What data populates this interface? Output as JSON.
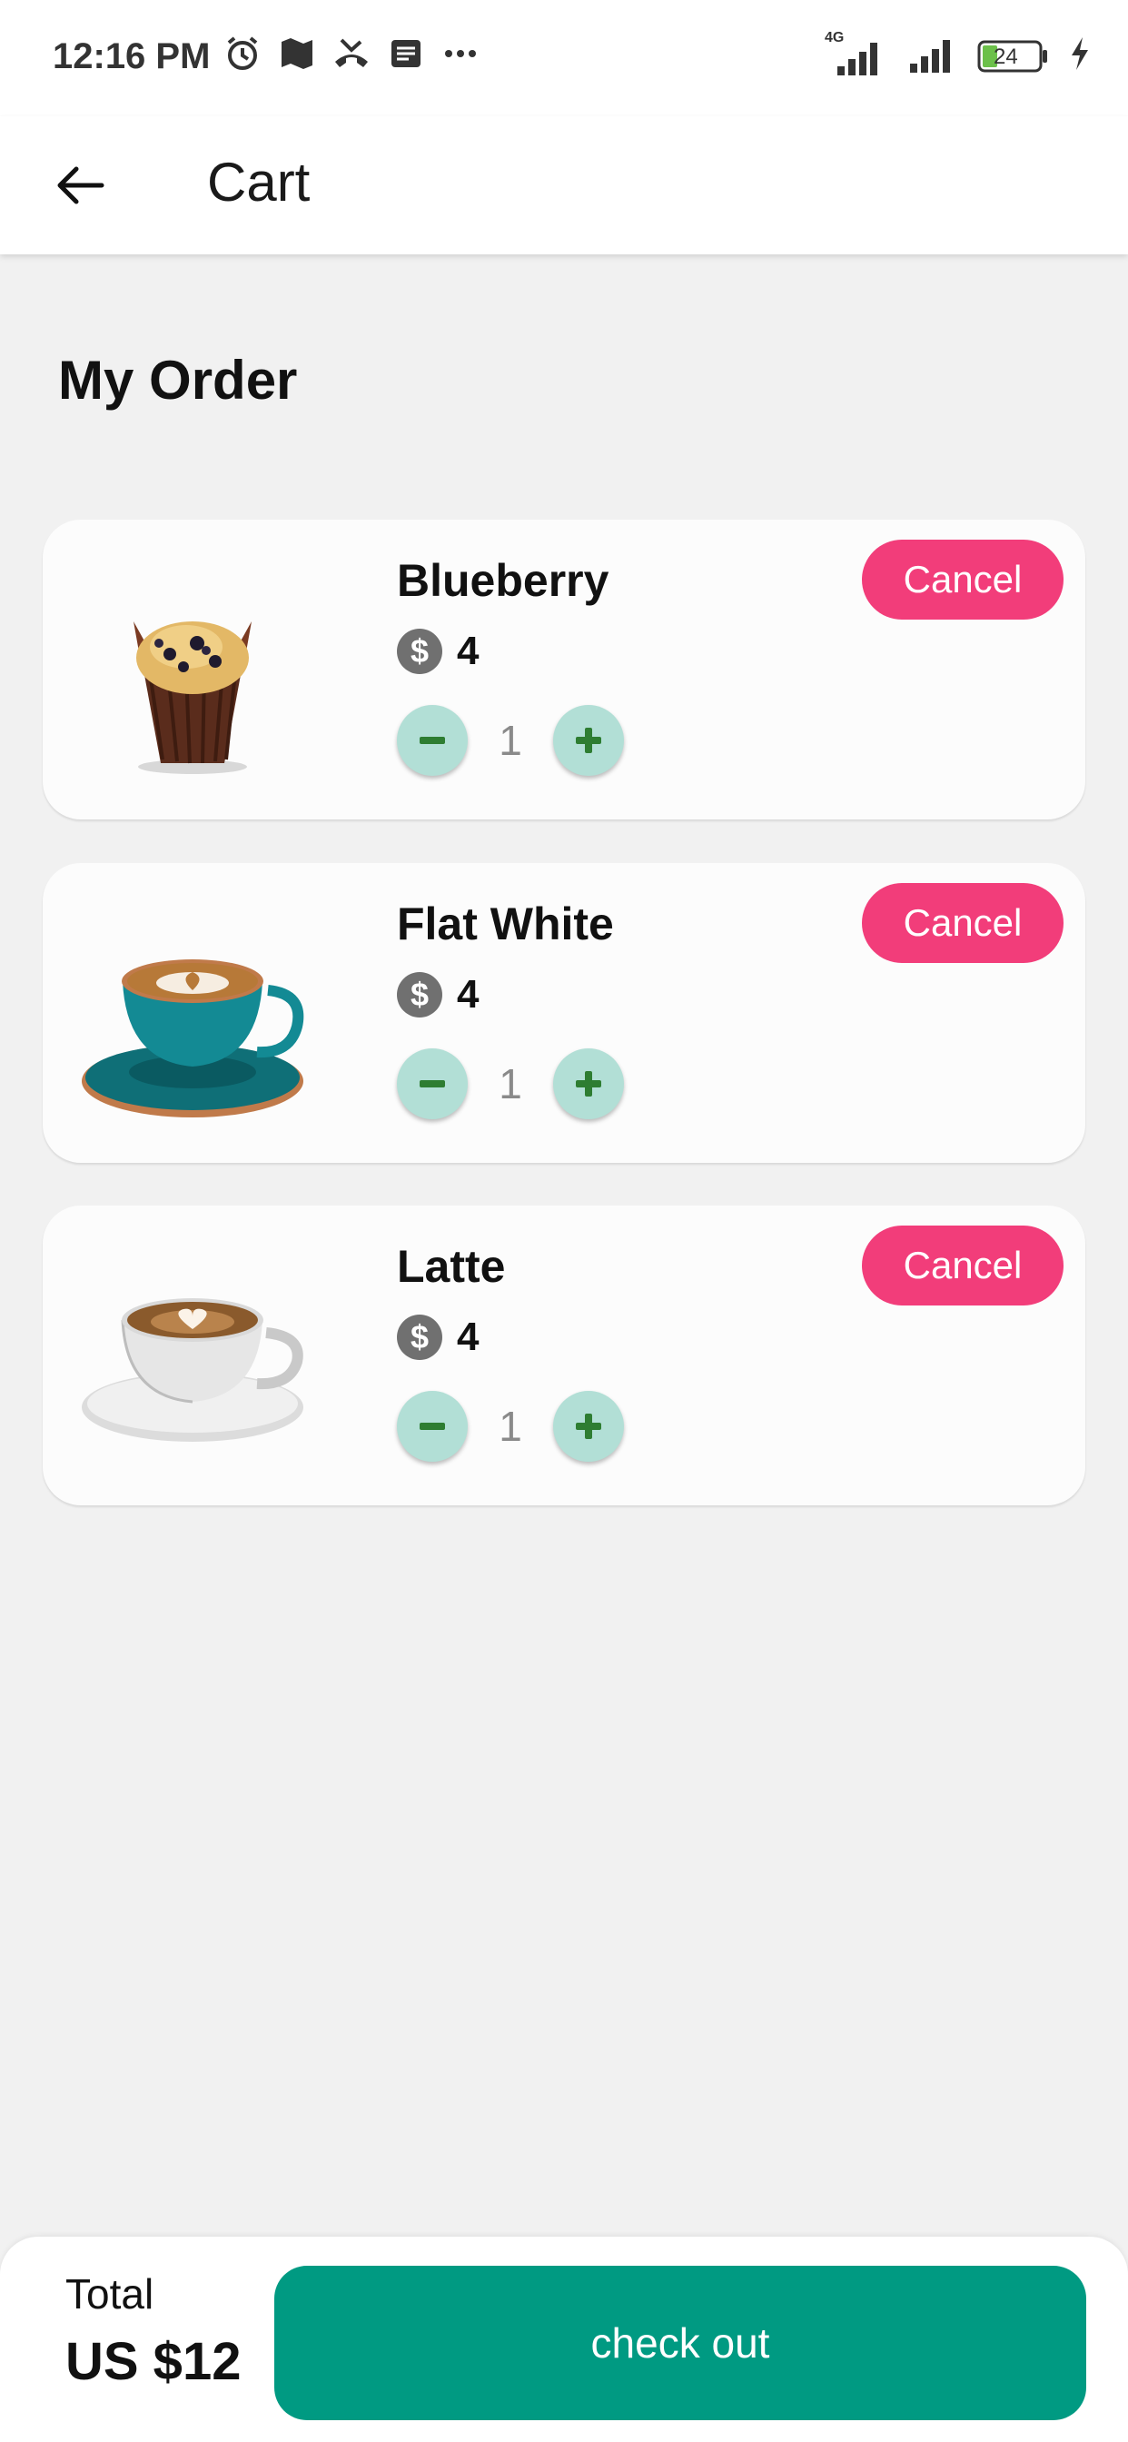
{
  "status_bar": {
    "time": "12:16 PM",
    "left_icons": [
      "alarm-icon",
      "maps-icon",
      "missed-call-icon",
      "message-icon",
      "more-dots-icon"
    ],
    "network": "4G",
    "battery": "24"
  },
  "app_bar": {
    "title": "Cart",
    "back_icon": "arrow-left-icon"
  },
  "section": {
    "title": "My Order"
  },
  "items": [
    {
      "name": "Blueberry",
      "price": "4",
      "quantity": "1",
      "cancel_label": "Cancel",
      "image": "blueberry-muffin"
    },
    {
      "name": "Flat White",
      "price": "4",
      "quantity": "1",
      "cancel_label": "Cancel",
      "image": "flat-white-cup"
    },
    {
      "name": "Latte",
      "price": "4",
      "quantity": "1",
      "cancel_label": "Cancel",
      "image": "latte-cup"
    }
  ],
  "currency_symbol": "$",
  "footer": {
    "total_label": "Total",
    "total_value": "US $12",
    "checkout_label": "check out"
  },
  "colors": {
    "accent": "#009a82",
    "cancel": "#f23d7a",
    "stepper": "#b2dfd6",
    "stepper_icon": "#2e7d32"
  }
}
